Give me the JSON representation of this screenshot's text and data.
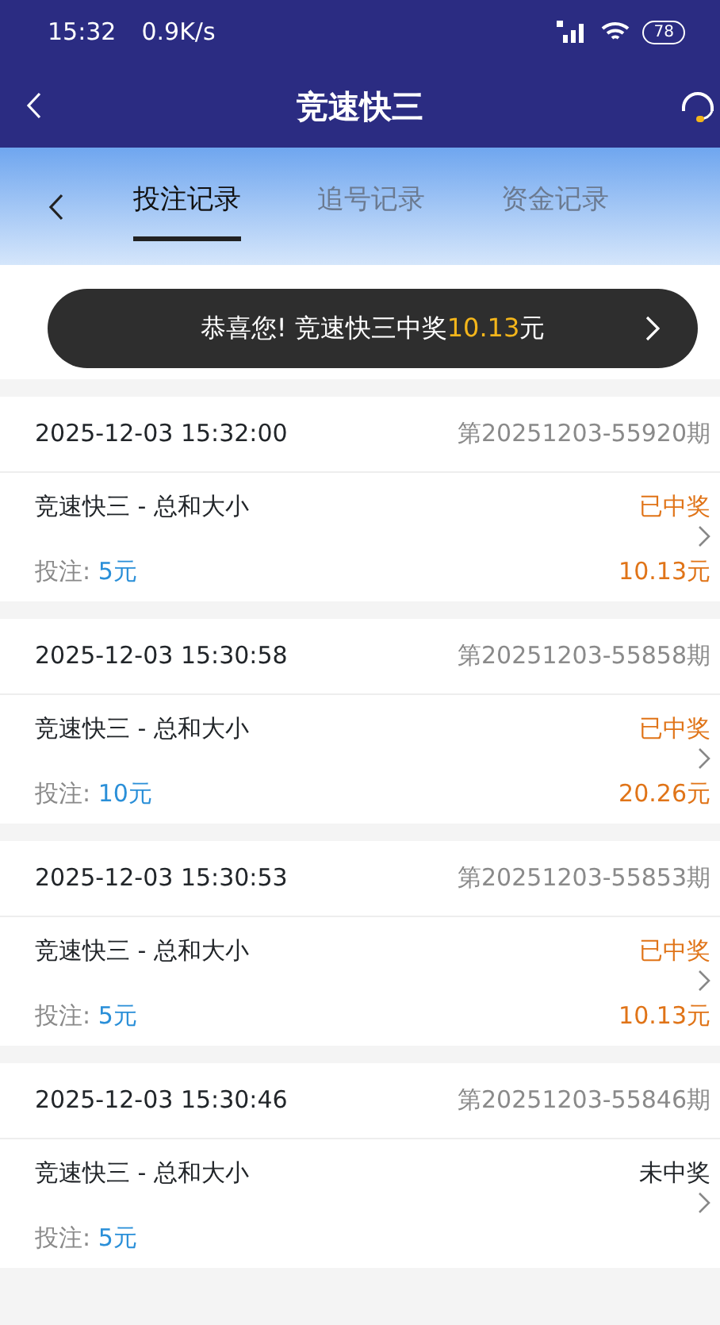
{
  "status_bar": {
    "time": "15:32",
    "speed": "0.9K/s",
    "battery": "78"
  },
  "header": {
    "title": "竞速快三"
  },
  "tabs": [
    {
      "label": "投注记录",
      "selected": true
    },
    {
      "label": "追号记录",
      "selected": false
    },
    {
      "label": "资金记录",
      "selected": false
    }
  ],
  "toast": {
    "text": "恭喜您! 竞速快三中奖",
    "amount": "10.13",
    "unit": "元"
  },
  "records": [
    {
      "time": "2025-12-03 15:32:00",
      "issue": "第20251203-55920期",
      "game": "竞速快三 - 总和大小",
      "status": "已中奖",
      "won": true,
      "stake_label": "投注:",
      "stake": "5元",
      "prize": "10.13元"
    },
    {
      "time": "2025-12-03 15:30:58",
      "issue": "第20251203-55858期",
      "game": "竞速快三 - 总和大小",
      "status": "已中奖",
      "won": true,
      "stake_label": "投注:",
      "stake": "10元",
      "prize": "20.26元"
    },
    {
      "time": "2025-12-03 15:30:53",
      "issue": "第20251203-55853期",
      "game": "竞速快三 - 总和大小",
      "status": "已中奖",
      "won": true,
      "stake_label": "投注:",
      "stake": "5元",
      "prize": "10.13元"
    },
    {
      "time": "2025-12-03 15:30:46",
      "issue": "第20251203-55846期",
      "game": "竞速快三 - 总和大小",
      "status": "未中奖",
      "won": false,
      "stake_label": "投注:",
      "stake": "5元"
    }
  ]
}
